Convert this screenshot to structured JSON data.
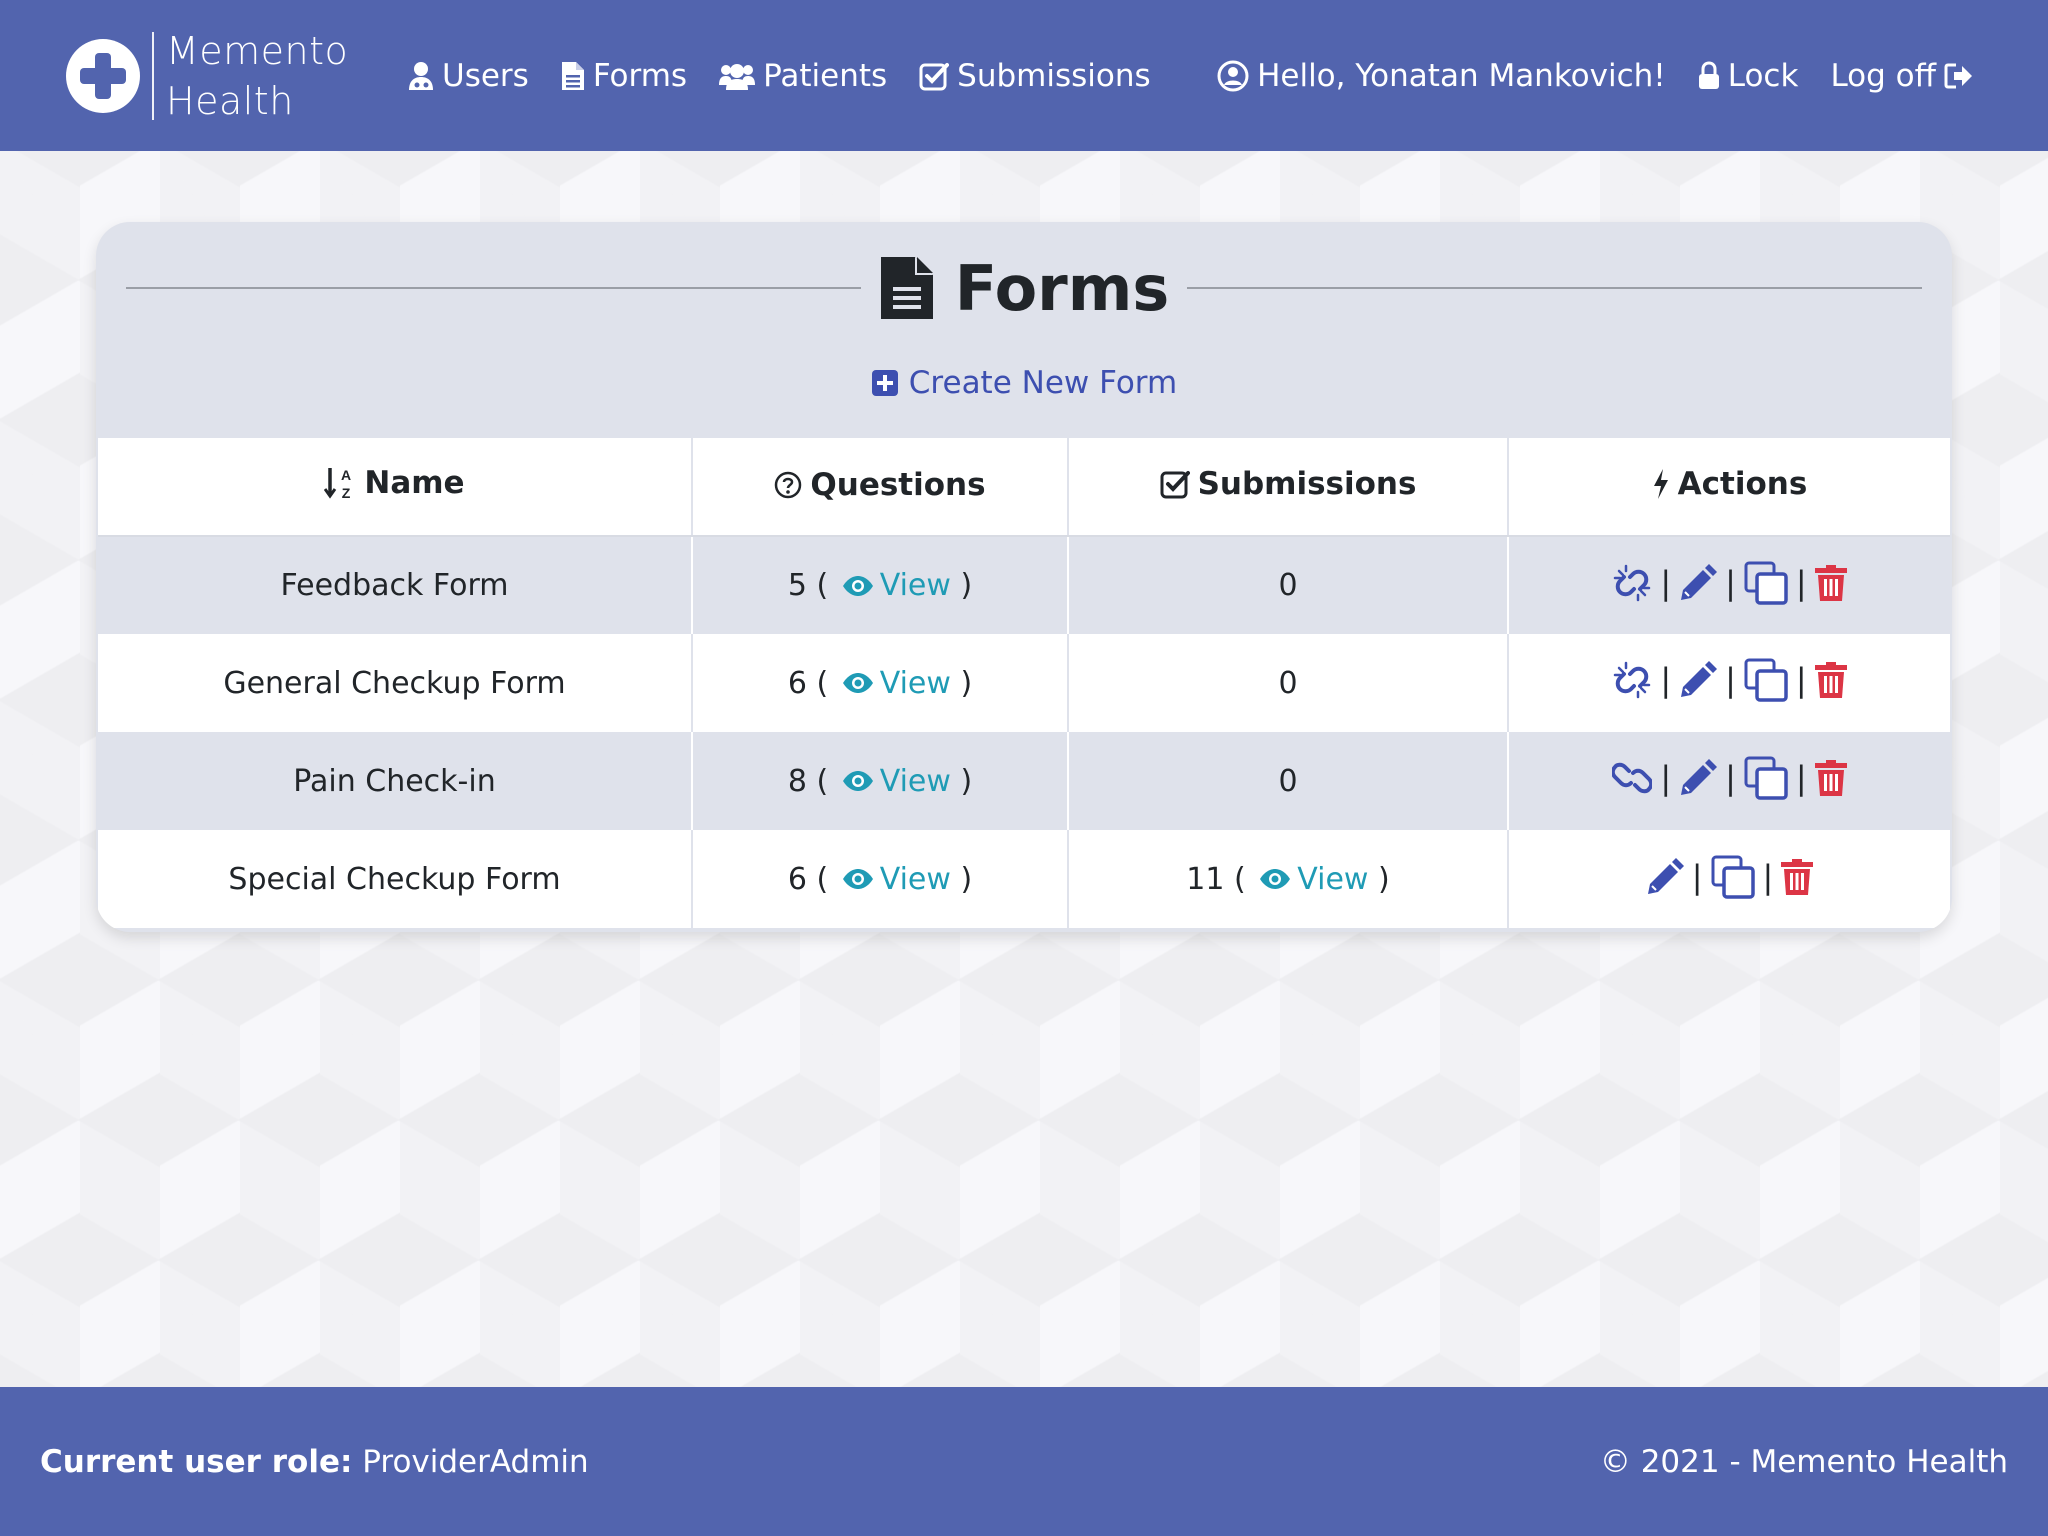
{
  "brand": {
    "line1": "Memento",
    "line2": "Health"
  },
  "nav": {
    "users": "Users",
    "forms": "Forms",
    "patients": "Patients",
    "submissions": "Submissions",
    "greeting": "Hello, Yonatan Mankovich!",
    "lock": "Lock",
    "logoff": "Log off"
  },
  "page": {
    "title": "Forms",
    "create_label": "Create New Form"
  },
  "table": {
    "headers": {
      "name": "Name",
      "questions": "Questions",
      "submissions": "Submissions",
      "actions": "Actions"
    },
    "view_label": "View",
    "rows": [
      {
        "name": "Feedback Form",
        "questions": "5",
        "submissions": "0",
        "link_state": "unlinked"
      },
      {
        "name": "General Checkup Form",
        "questions": "6",
        "submissions": "0",
        "link_state": "unlinked"
      },
      {
        "name": "Pain Check-in",
        "questions": "8",
        "submissions": "0",
        "link_state": "linked"
      },
      {
        "name": "Special Checkup Form",
        "questions": "6",
        "submissions": "11",
        "link_state": "none"
      }
    ]
  },
  "footer": {
    "role_label": "Current user role:",
    "role_value": "ProviderAdmin",
    "copyright": "© 2021 - Memento Health"
  },
  "colors": {
    "navbar": "#5264ae",
    "link": "#3d4fb0",
    "view": "#1f9bb5",
    "danger": "#dc3545",
    "card": "#dfe2eb"
  }
}
